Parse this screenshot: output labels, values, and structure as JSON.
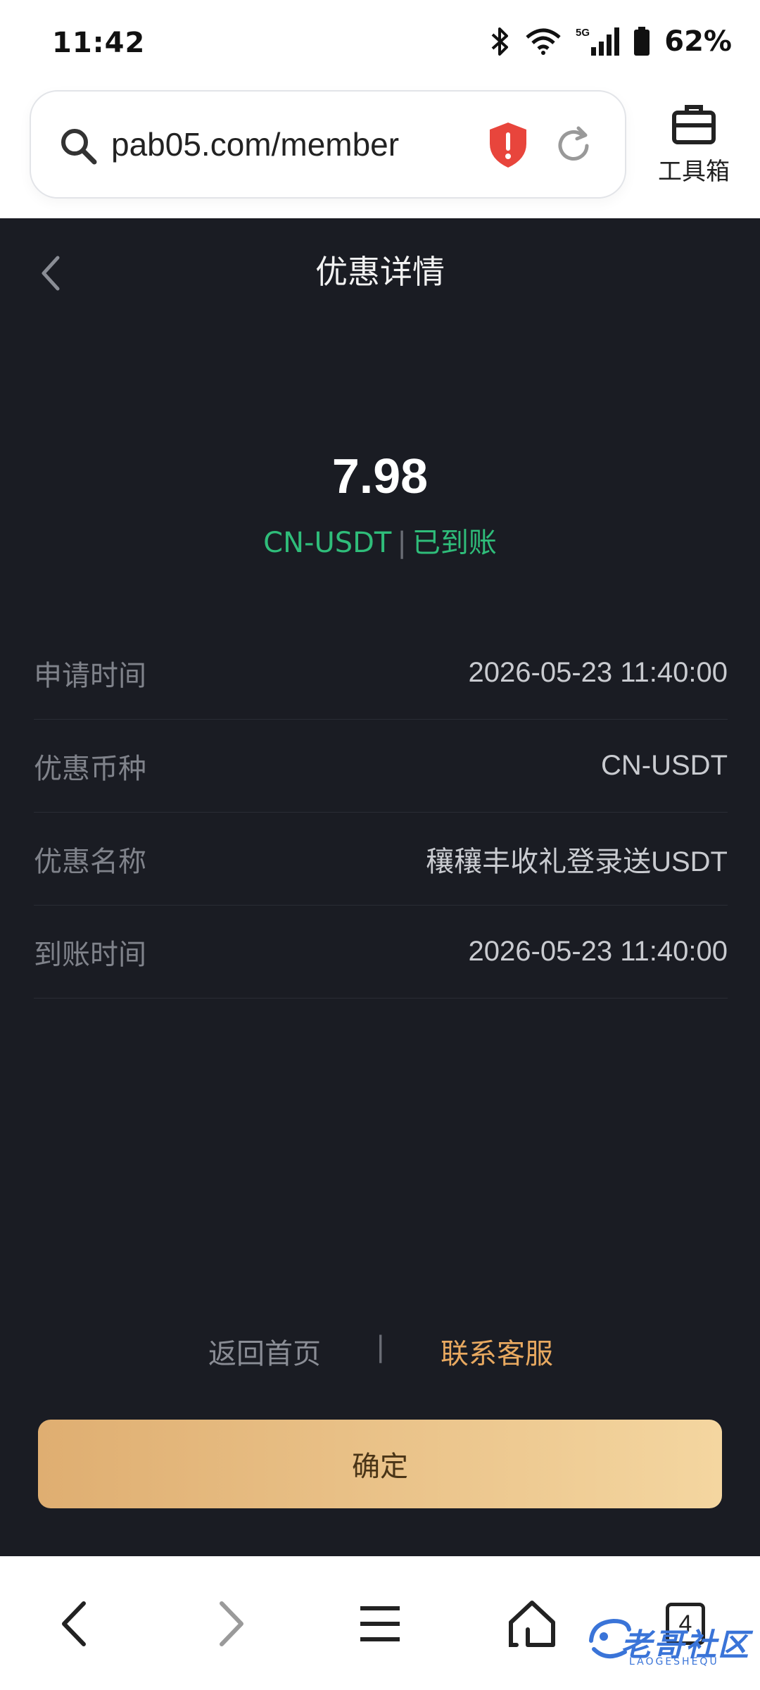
{
  "status_bar": {
    "time": "11:42",
    "battery_pct": "62%",
    "network": "5G"
  },
  "browser": {
    "url": "pab05.com/member",
    "toolbox_label": "工具箱"
  },
  "page": {
    "title": "优惠详情",
    "amount": "7.98",
    "currency": "CN-USDT",
    "status": "已到账",
    "separator": "|",
    "rows": [
      {
        "label": "申请时间",
        "value": "2026-05-23 11:40:00"
      },
      {
        "label": "优惠币种",
        "value": "CN-USDT"
      },
      {
        "label": "优惠名称",
        "value": "穰穰丰收礼登录送USDT"
      },
      {
        "label": "到账时间",
        "value": "2026-05-23 11:40:00"
      }
    ],
    "link_home": "返回首页",
    "link_sep": "|",
    "link_service": "联系客服",
    "confirm": "确定"
  },
  "bottom_nav": {
    "tabs_count": "4",
    "watermark": "老哥社区",
    "watermark_sub": "LAOGESHEQU"
  },
  "colors": {
    "page_bg": "#1a1c23",
    "status_green": "#2fbd7a",
    "service_orange": "#e8a960",
    "button_gradient_start": "#dfae71",
    "button_gradient_end": "#f4d6a0"
  }
}
